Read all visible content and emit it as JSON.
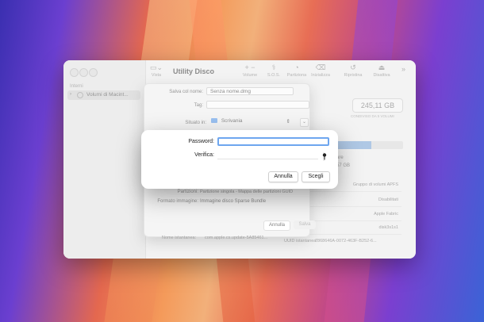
{
  "window": {
    "title": "Utility Disco",
    "toolbar": [
      {
        "label": "Vista",
        "icon": "sidebar-icon"
      },
      {
        "label": "Volume",
        "icon": "plus-minus-icon"
      },
      {
        "label": "S.O.S.",
        "icon": "stethoscope-icon"
      },
      {
        "label": "Partiziona",
        "icon": "pie-icon"
      },
      {
        "label": "Inizializza",
        "icon": "eraser-icon"
      },
      {
        "label": "Ripristina",
        "icon": "restore-icon"
      },
      {
        "label": "Disattiva",
        "icon": "eject-icon"
      }
    ],
    "sidebar": {
      "section": "Interni",
      "item": "Volumi di Macint..."
    },
    "capacity": "245,11 GB",
    "capacity_sub": "CONDIVISO DA 5 VOLUMI",
    "usage_fraction": 0.55,
    "fragments": [
      "are",
      "57 GB"
    ],
    "info_rows": [
      "Gruppo di volumi APFS",
      "Disabilitati",
      "Apple Fabric",
      "disk3s1s1"
    ],
    "uuid": {
      "label": "UUID istantanea:",
      "value": "7868646A-0072-463F-B252-6..."
    }
  },
  "sheet": {
    "save_as_label": "Salva col nome:",
    "save_as_value": "Senza nome.dmg",
    "tag_label": "Tag:",
    "location_label": "Situato in:",
    "location_value": "Scrivania",
    "partitions_label": "Partizioni:",
    "partitions_value": "Partizione singola - Mappa delle partizioni GUID",
    "format_label": "Formato immagine:",
    "format_value": "Immagine disco Sparse Bundle",
    "snapshot_label": "Nome istantanea:",
    "snapshot_value": "com.apple.cs.update-5A85461...",
    "cancel": "Annulla",
    "save": "Salva"
  },
  "dialog": {
    "password_label": "Password:",
    "verify_label": "Verifica:",
    "password_value": "",
    "verify_value": "",
    "cancel": "Annulla",
    "choose": "Scegli"
  }
}
